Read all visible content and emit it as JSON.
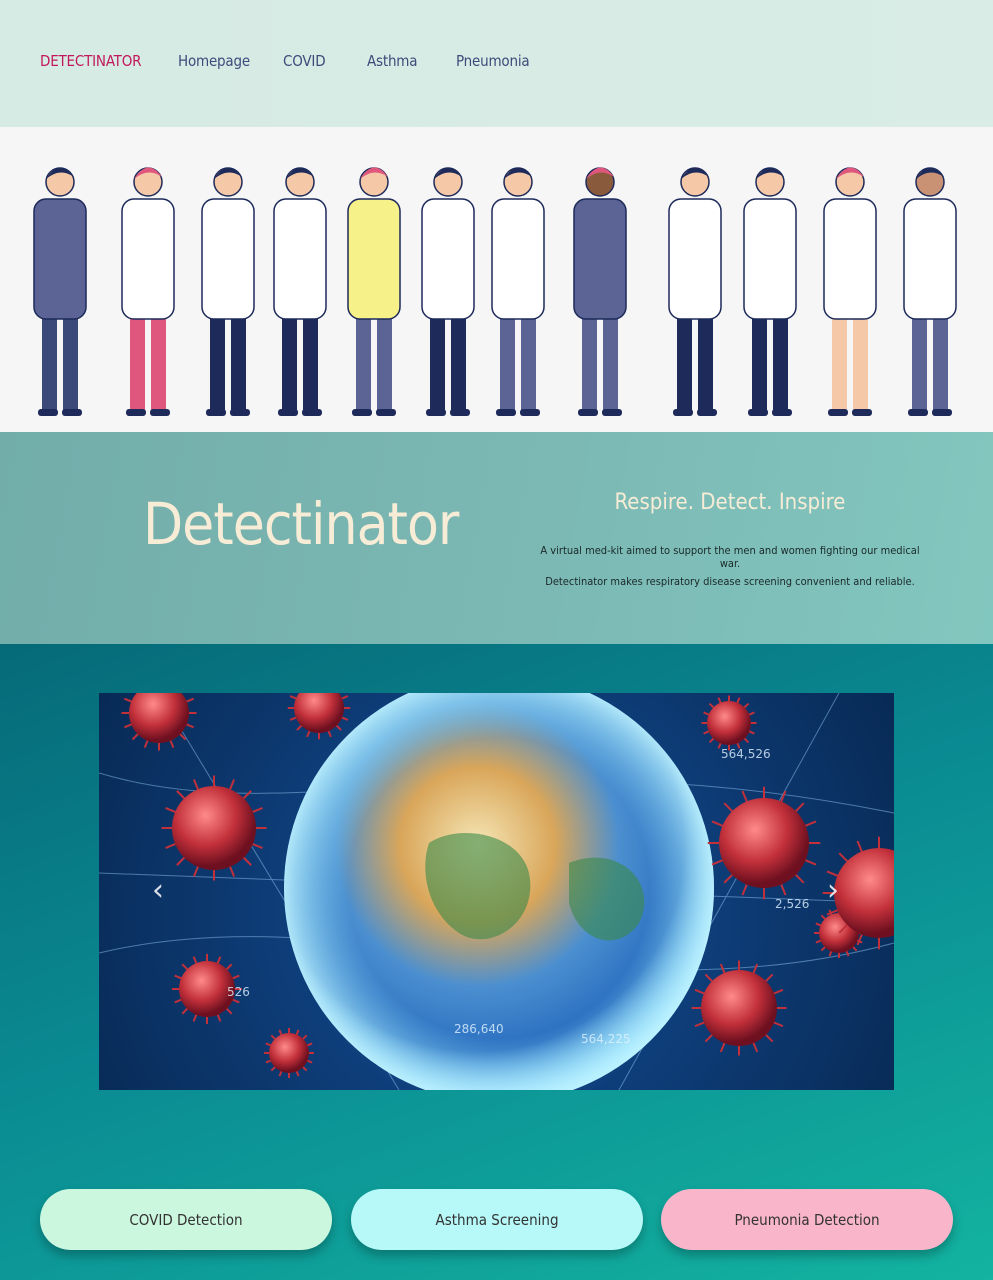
{
  "nav": {
    "brand": "DETECTINATOR",
    "links": [
      "Homepage",
      "COVID",
      "Asthma",
      "Pneumonia"
    ]
  },
  "hero_image": {
    "description_icon": "medical-team-illustration"
  },
  "intro": {
    "title": "Detectinator",
    "tagline": "Respire. Detect. Inspire",
    "description_1": "A virtual med-kit aimed to support the men and women fighting our medical war.",
    "description_2": "Detectinator makes respiratory disease screening convenient and reliable."
  },
  "carousel": {
    "image_icon": "globe-virus-image",
    "prev_icon": "chevron-left-icon",
    "next_icon": "chevron-right-icon",
    "overlay_numbers": [
      "564,526",
      "526",
      "286,640",
      "564,225",
      "2,526"
    ],
    "prev_glyph": "‹",
    "next_glyph": "›"
  },
  "actions": {
    "covid": "COVID Detection",
    "asthma": "Asthma Screening",
    "pneumonia": "Pneumonia Detection"
  },
  "colors": {
    "brand": "#c2185b",
    "nav_link": "#3f4a7a",
    "title": "#f7ecd6",
    "covid_btn": "#cbf7df",
    "asthma_btn": "#b6f9f8",
    "pneumonia_btn": "#f9b6cb"
  }
}
